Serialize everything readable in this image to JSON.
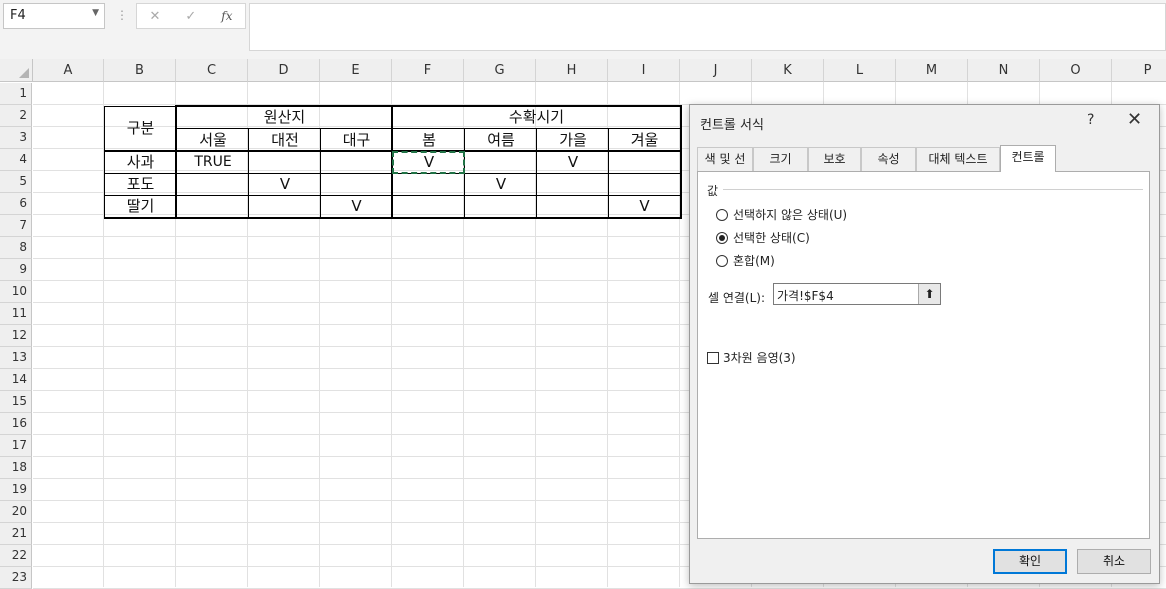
{
  "formula_bar": {
    "name_box": "F4",
    "cancel_glyph": "✕",
    "enter_glyph": "✓",
    "fx_glyph": "fx",
    "formula": ""
  },
  "columns": [
    "A",
    "B",
    "C",
    "D",
    "E",
    "F",
    "G",
    "H",
    "I",
    "J",
    "K",
    "L",
    "M",
    "N",
    "O",
    "P"
  ],
  "rows": [
    "1",
    "2",
    "3",
    "4",
    "5",
    "6",
    "7",
    "8",
    "9",
    "10",
    "11",
    "12",
    "13",
    "14",
    "15",
    "16",
    "17",
    "18",
    "19",
    "20",
    "21",
    "22",
    "23"
  ],
  "table": {
    "header_b": "구분",
    "origin_group": "원산지",
    "harvest_group": "수확시기",
    "origin_cols": [
      "서울",
      "대전",
      "대구"
    ],
    "season_cols": [
      "봄",
      "여름",
      "가을",
      "겨울"
    ],
    "row_labels": [
      "사과",
      "포도",
      "딸기"
    ],
    "cells": {
      "C4": "TRUE",
      "F4": "V",
      "H4": "V",
      "D5": "V",
      "G5": "V",
      "E6": "V",
      "I6": "V"
    }
  },
  "dialog": {
    "title": "컨트롤 서식",
    "help": "?",
    "close": "✕",
    "tabs": [
      "색 및 선",
      "크기",
      "보호",
      "속성",
      "대체 텍스트",
      "컨트롤"
    ],
    "active_tab": "컨트롤",
    "value_group": "값",
    "radio_unchecked": "선택하지 않은 상태(U)",
    "radio_checked": "선택한 상태(C)",
    "radio_mixed": "혼합(M)",
    "selected_radio": "선택한 상태(C)",
    "cell_link_label": "셀 연결(L):",
    "cell_link_value": "가격!$F$4",
    "shading_label": "3차원 음영(3)",
    "shading_checked": false,
    "ok": "확인",
    "cancel": "취소"
  }
}
